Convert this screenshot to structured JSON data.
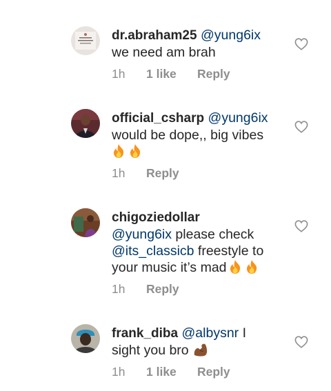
{
  "comments": [
    {
      "username": "dr.abraham25",
      "mention": "@yung6ix",
      "text_line1": "we need am brah",
      "time": "1h",
      "likes": "1 like",
      "reply": "Reply"
    },
    {
      "username": "official_csharp",
      "mention": "@yung6ix",
      "text_line1": "would be dope,, big vibes",
      "emoji": "fire fire",
      "time": "1h",
      "reply": "Reply"
    },
    {
      "username": "chigoziedollar",
      "mention": "@yung6ix",
      "text_after_mention": " please check",
      "mention2": "@its_classicb",
      "text_after_mention2": " freestyle to",
      "text_line3": "your music it’s mad",
      "emoji": "fire fire",
      "time": "1h",
      "reply": "Reply"
    },
    {
      "username": "frank_diba",
      "mention": "@albysnr",
      "text_after_mention": " I",
      "text_line2": "sight you bro",
      "emoji": "flexed-biceps",
      "time": "1h",
      "likes": "1 like",
      "reply": "Reply"
    }
  ],
  "icons": {
    "like": "heart-outline-icon",
    "fire": "fire-emoji-icon",
    "flex": "flexed-biceps-emoji-icon"
  },
  "colors": {
    "text": "#262626",
    "mention": "#00376b",
    "meta": "#8e8e8e"
  }
}
